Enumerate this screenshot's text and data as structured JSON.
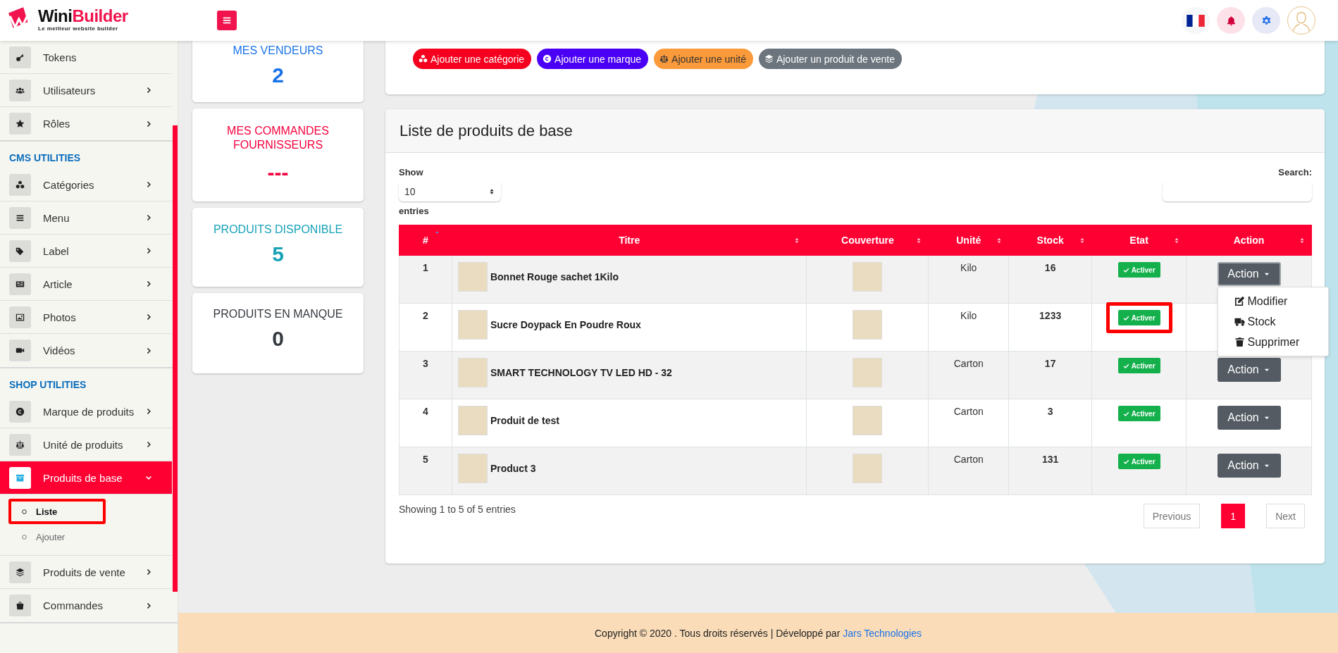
{
  "header": {
    "logo": {
      "word_1": "Wini",
      "word_2": "Builder",
      "tagline": "Le meilleur website builder"
    }
  },
  "sidebar": {
    "groups": [
      {
        "items": [
          {
            "label": "Tokens",
            "selected": false
          },
          {
            "label": "Utilisateurs",
            "selected": false,
            "expanded": false
          },
          {
            "label": "Rôles",
            "selected": false,
            "expanded": false
          }
        ]
      },
      {
        "title": "CMS UTILITIES",
        "items": [
          {
            "label": "Catégories",
            "selected": false,
            "expanded": false
          },
          {
            "label": "Menu",
            "selected": false,
            "expanded": false
          },
          {
            "label": "Label",
            "selected": false,
            "expanded": false
          },
          {
            "label": "Article",
            "selected": false,
            "expanded": false
          },
          {
            "label": "Photos",
            "selected": false,
            "expanded": false
          },
          {
            "label": "Vidéos",
            "selected": false,
            "expanded": false
          }
        ]
      },
      {
        "title": "SHOP UTILITIES",
        "items": [
          {
            "label": "Marque de produits",
            "selected": false,
            "expanded": false
          },
          {
            "label": "Unité de produits",
            "selected": false,
            "expanded": false
          },
          {
            "label": "Produits de base",
            "selected": true,
            "expanded": true,
            "children": [
              {
                "label": "Liste",
                "selected": true,
                "highlighted": true
              },
              {
                "label": "Ajouter",
                "selected": false,
                "highlighted": false
              }
            ]
          },
          {
            "label": "Produits de vente",
            "selected": false,
            "expanded": false
          },
          {
            "label": "Commandes",
            "selected": false,
            "expanded": false
          }
        ]
      }
    ]
  },
  "stats": [
    {
      "label": "MES VENDEURS",
      "value": "2",
      "color": "#1a73e8"
    },
    {
      "label": "MES COMMANDES FOURNISSEURS",
      "value": "---",
      "color": "#f5003d"
    },
    {
      "label": "PRODUITS DISPONIBLE",
      "value": "5",
      "color": "#17a2b8"
    },
    {
      "label": "PRODUITS EN MANQUE",
      "value": "0",
      "color": "#343a40"
    }
  ],
  "quick_actions": [
    {
      "label": "Ajouter une catégorie",
      "color": "#f5001e"
    },
    {
      "label": "Ajouter une marque",
      "color": "#4a00f5"
    },
    {
      "label": "Ajouter une unité",
      "color": "#fb9a3a"
    },
    {
      "label": "Ajouter un produit de vente",
      "color": "#6c757d"
    }
  ],
  "table": {
    "title": "Liste de produits de base",
    "length": {
      "label": "Show",
      "value": "10",
      "suffix": "entries"
    },
    "search": {
      "label": "Search:"
    },
    "columns": [
      {
        "label": "#",
        "sorted": true
      },
      {
        "label": "Titre",
        "sorted": false
      },
      {
        "label": "Couverture",
        "sorted": false
      },
      {
        "label": "Unité",
        "sorted": false
      },
      {
        "label": "Stock",
        "sorted": false
      },
      {
        "label": "Etat",
        "sorted": false
      },
      {
        "label": "Action",
        "sorted": false
      }
    ],
    "rows": [
      {
        "number": "1",
        "title": "Bonnet Rouge sachet 1Kilo",
        "unit": "Kilo",
        "stock": "16",
        "state": "Activer",
        "highlighted": false,
        "action": "Action",
        "menu_open": true
      },
      {
        "number": "2",
        "title": "Sucre Doypack En Poudre Roux",
        "unit": "Kilo",
        "stock": "1233",
        "state": "Activer",
        "highlighted": true,
        "menu_open": false
      },
      {
        "number": "3",
        "title": "SMART TECHNOLOGY TV LED HD - 32",
        "unit": "Carton",
        "stock": "17",
        "state": "Activer",
        "highlighted": false,
        "action": "Action",
        "menu_open": false
      },
      {
        "number": "4",
        "title": "Produit de test",
        "unit": "Carton",
        "stock": "3",
        "state": "Activer",
        "highlighted": false,
        "action": "Action",
        "menu_open": false
      },
      {
        "number": "5",
        "title": "Product 3",
        "unit": "Carton",
        "stock": "131",
        "state": "Activer",
        "highlighted": false,
        "action": "Action",
        "menu_open": false
      }
    ],
    "action_menu": [
      {
        "label": "Modifier"
      },
      {
        "label": "Stock"
      },
      {
        "label": "Supprimer"
      }
    ],
    "info": "Showing 1 to 5 of 5 entries",
    "pagination": {
      "previous": "Previous",
      "pages": [
        {
          "label": "1",
          "selected": true
        }
      ],
      "next": "Next"
    }
  },
  "footer": {
    "text": "Copyright © 2020 . Tous droits réservés | Développé par ",
    "link": "Jars Technologies"
  }
}
